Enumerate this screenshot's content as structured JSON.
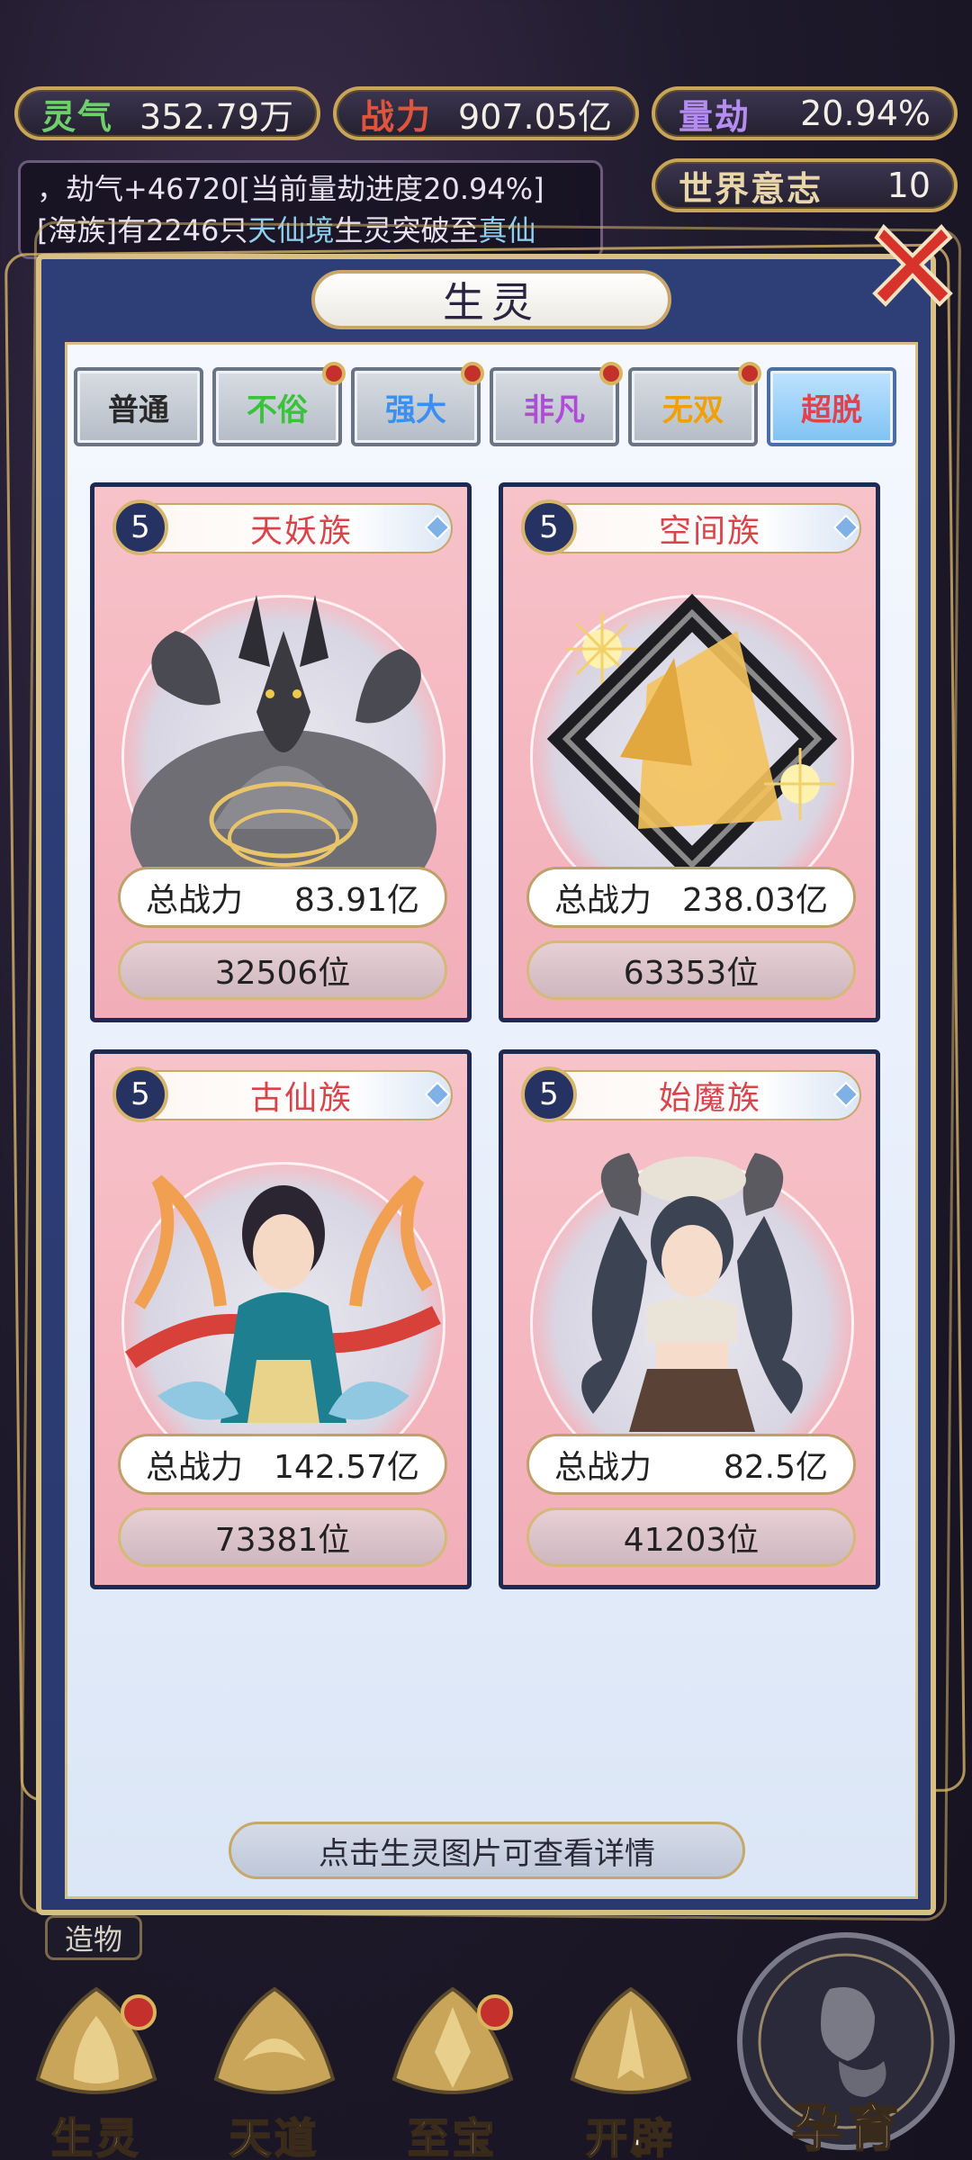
{
  "resources": [
    {
      "label": "灵气",
      "value": "352.79万",
      "label_color": "#6ed06a"
    },
    {
      "label": "战力",
      "value": "907.05亿",
      "label_color": "#e0543e"
    },
    {
      "label": "量劫",
      "value": "20.94%",
      "label_color": "#b58cf0"
    },
    {
      "label": "世界意志",
      "value": "10",
      "label_color": "#e9d7a9"
    }
  ],
  "news": {
    "line1": "，劫气+46720[当前量劫进度20.94%]",
    "line2_prefix": "[海族]有2246只",
    "line2_realm": "天仙境",
    "line2_mid": "生灵突破至",
    "line2_target": "真仙"
  },
  "modal": {
    "title": "生灵",
    "hint": "点击生灵图片可查看详情"
  },
  "tabs": [
    {
      "label": "普通",
      "color": "#2a2a2a",
      "badge": false,
      "active": false
    },
    {
      "label": "不俗",
      "color": "#39c23a",
      "badge": true,
      "active": false
    },
    {
      "label": "强大",
      "color": "#3a8ff0",
      "badge": true,
      "active": false
    },
    {
      "label": "非凡",
      "color": "#b04ad8",
      "badge": true,
      "active": false
    },
    {
      "label": "无双",
      "color": "#f0a000",
      "badge": true,
      "active": false
    },
    {
      "label": "超脱",
      "color": "#e0434c",
      "badge": false,
      "active": true
    }
  ],
  "cards": [
    {
      "level": "5",
      "name": "天妖族",
      "power_label": "总战力",
      "power": "83.91亿",
      "rank": "32506位",
      "art": "dragon-hydra"
    },
    {
      "level": "5",
      "name": "空间族",
      "power_label": "总战力",
      "power": "238.03亿",
      "rank": "63353位",
      "art": "geometric-frame"
    },
    {
      "level": "5",
      "name": "古仙族",
      "power_label": "总战力",
      "power": "142.57亿",
      "rank": "73381位",
      "art": "immortal-maiden"
    },
    {
      "level": "5",
      "name": "始魔族",
      "power_label": "总战力",
      "power": "82.5亿",
      "rank": "41203位",
      "art": "horned-demon-girl"
    }
  ],
  "bottom_nav": [
    {
      "label": "生灵",
      "badge": true,
      "icon": "creature-emblem-icon"
    },
    {
      "label": "天道",
      "badge": false,
      "icon": "heaven-dao-emblem-icon"
    },
    {
      "label": "至宝",
      "badge": true,
      "icon": "treasure-emblem-icon"
    },
    {
      "label": "开辟",
      "badge": false,
      "icon": "creation-emblem-icon"
    }
  ],
  "side_tag": "造物",
  "incubate_label": "孕育"
}
